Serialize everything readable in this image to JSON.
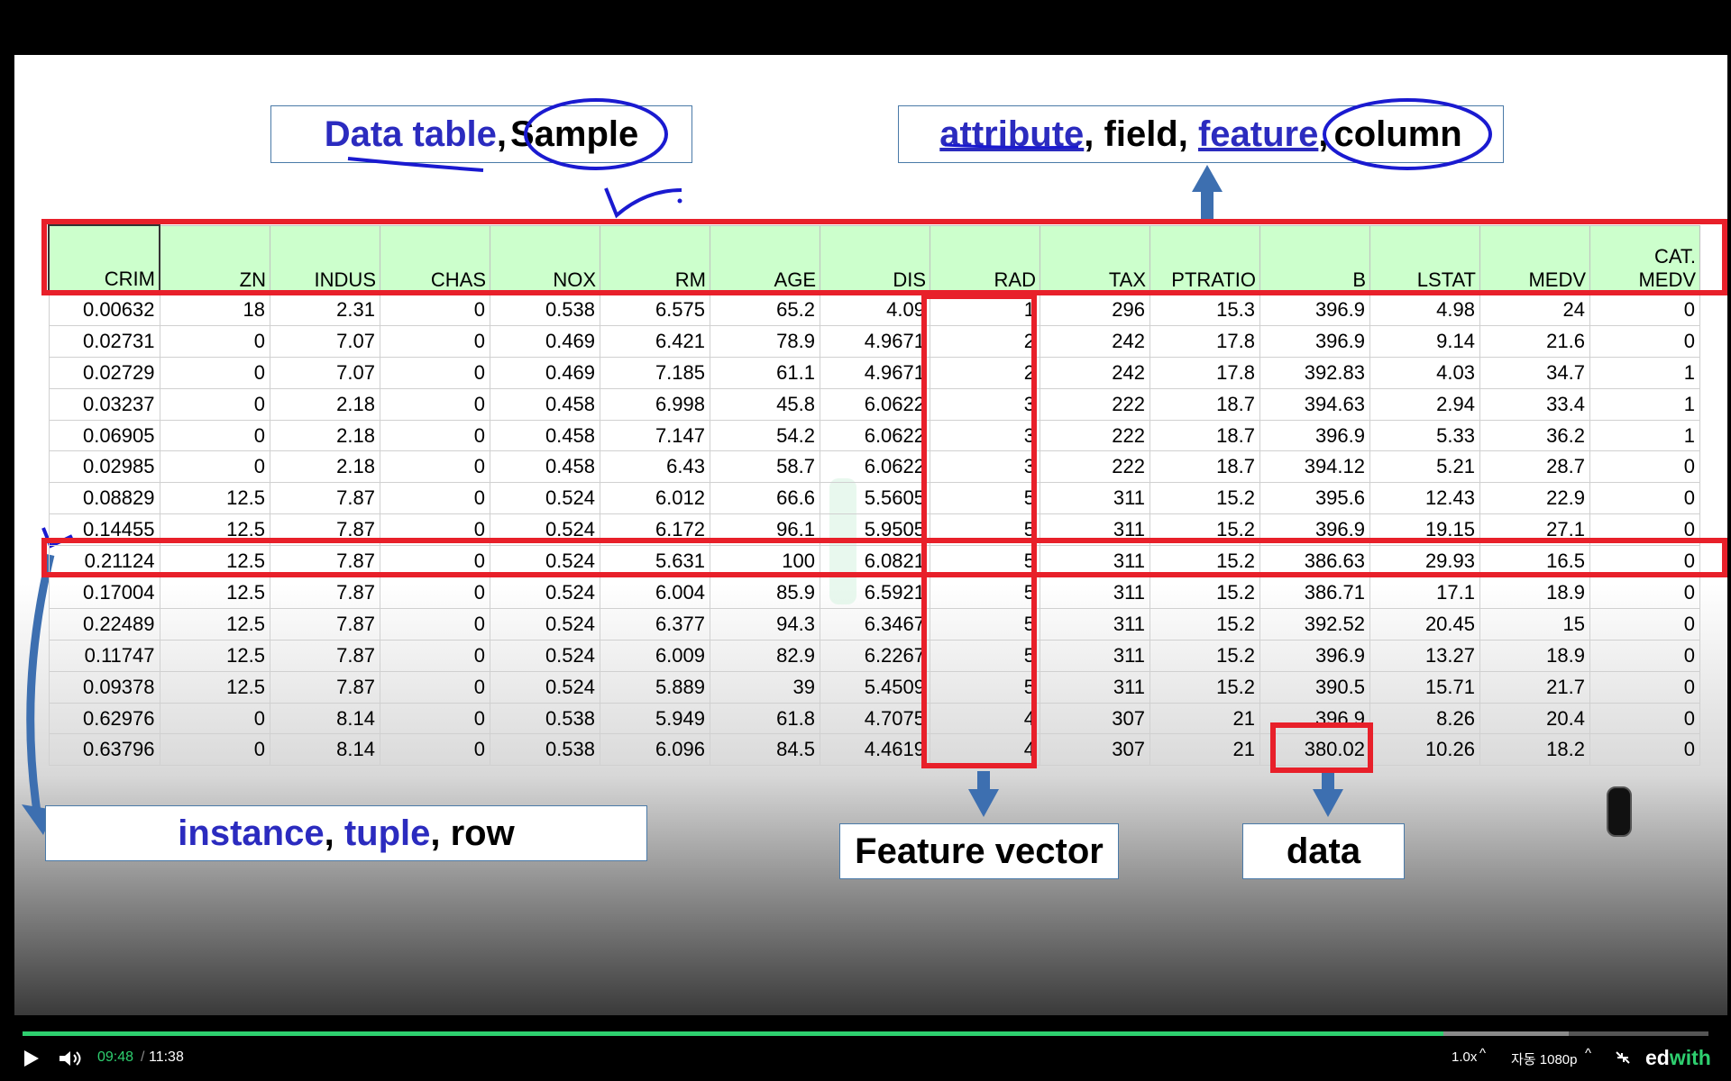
{
  "slide": {
    "data_table_label": {
      "part1": "Data table",
      "sep": ",",
      "part2": "Sample"
    },
    "attribute_label": {
      "a": "attribute",
      "b": ", field, ",
      "c": "feature",
      "d": ",",
      "e": "column"
    },
    "instance_label": {
      "a": "instance",
      "b": ", ",
      "c": "tuple",
      "d": ", row"
    },
    "feature_vector_label": "Feature vector",
    "data_label": "data"
  },
  "table": {
    "headers": [
      "CRIM",
      "ZN",
      "INDUS",
      "CHAS",
      "NOX",
      "RM",
      "AGE",
      "DIS",
      "RAD",
      "TAX",
      "PTRATIO",
      "B",
      "LSTAT",
      "MEDV",
      "CAT.\nMEDV"
    ],
    "rows": [
      [
        "0.00632",
        "18",
        "2.31",
        "0",
        "0.538",
        "6.575",
        "65.2",
        "4.09",
        "1",
        "296",
        "15.3",
        "396.9",
        "4.98",
        "24",
        "0"
      ],
      [
        "0.02731",
        "0",
        "7.07",
        "0",
        "0.469",
        "6.421",
        "78.9",
        "4.9671",
        "2",
        "242",
        "17.8",
        "396.9",
        "9.14",
        "21.6",
        "0"
      ],
      [
        "0.02729",
        "0",
        "7.07",
        "0",
        "0.469",
        "7.185",
        "61.1",
        "4.9671",
        "2",
        "242",
        "17.8",
        "392.83",
        "4.03",
        "34.7",
        "1"
      ],
      [
        "0.03237",
        "0",
        "2.18",
        "0",
        "0.458",
        "6.998",
        "45.8",
        "6.0622",
        "3",
        "222",
        "18.7",
        "394.63",
        "2.94",
        "33.4",
        "1"
      ],
      [
        "0.06905",
        "0",
        "2.18",
        "0",
        "0.458",
        "7.147",
        "54.2",
        "6.0622",
        "3",
        "222",
        "18.7",
        "396.9",
        "5.33",
        "36.2",
        "1"
      ],
      [
        "0.02985",
        "0",
        "2.18",
        "0",
        "0.458",
        "6.43",
        "58.7",
        "6.0622",
        "3",
        "222",
        "18.7",
        "394.12",
        "5.21",
        "28.7",
        "0"
      ],
      [
        "0.08829",
        "12.5",
        "7.87",
        "0",
        "0.524",
        "6.012",
        "66.6",
        "5.5605",
        "5",
        "311",
        "15.2",
        "395.6",
        "12.43",
        "22.9",
        "0"
      ],
      [
        "0.14455",
        "12.5",
        "7.87",
        "0",
        "0.524",
        "6.172",
        "96.1",
        "5.9505",
        "5",
        "311",
        "15.2",
        "396.9",
        "19.15",
        "27.1",
        "0"
      ],
      [
        "0.21124",
        "12.5",
        "7.87",
        "0",
        "0.524",
        "5.631",
        "100",
        "6.0821",
        "5",
        "311",
        "15.2",
        "386.63",
        "29.93",
        "16.5",
        "0"
      ],
      [
        "0.17004",
        "12.5",
        "7.87",
        "0",
        "0.524",
        "6.004",
        "85.9",
        "6.5921",
        "5",
        "311",
        "15.2",
        "386.71",
        "17.1",
        "18.9",
        "0"
      ],
      [
        "0.22489",
        "12.5",
        "7.87",
        "0",
        "0.524",
        "6.377",
        "94.3",
        "6.3467",
        "5",
        "311",
        "15.2",
        "392.52",
        "20.45",
        "15",
        "0"
      ],
      [
        "0.11747",
        "12.5",
        "7.87",
        "0",
        "0.524",
        "6.009",
        "82.9",
        "6.2267",
        "5",
        "311",
        "15.2",
        "396.9",
        "13.27",
        "18.9",
        "0"
      ],
      [
        "0.09378",
        "12.5",
        "7.87",
        "0",
        "0.524",
        "5.889",
        "39",
        "5.4509",
        "5",
        "311",
        "15.2",
        "390.5",
        "15.71",
        "21.7",
        "0"
      ],
      [
        "0.62976",
        "0",
        "8.14",
        "0",
        "0.538",
        "5.949",
        "61.8",
        "4.7075",
        "4",
        "307",
        "21",
        "396.9",
        "8.26",
        "20.4",
        "0"
      ],
      [
        "0.63796",
        "0",
        "8.14",
        "0",
        "0.538",
        "6.096",
        "84.5",
        "4.4619",
        "4",
        "307",
        "21",
        "380.02",
        "10.26",
        "18.2",
        "0"
      ]
    ]
  },
  "player": {
    "current_time": "09:48",
    "separator": "/",
    "total_time": "11:38",
    "progress": 0.843,
    "buffered": 0.917,
    "speed": "1.0x",
    "quality": "자동 1080p",
    "brand": {
      "ed": "ed",
      "with": "with"
    },
    "accent_color": "#2ecf6f"
  }
}
